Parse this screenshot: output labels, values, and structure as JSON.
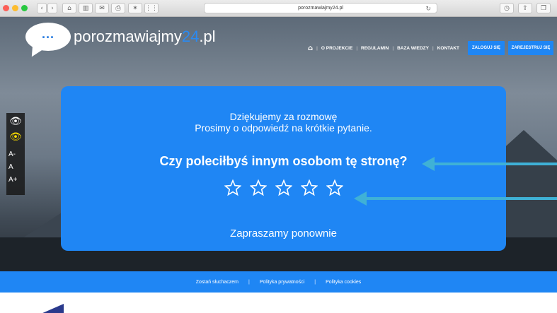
{
  "browser": {
    "url": "porozmawiajmy24.pl"
  },
  "site": {
    "logo_name": "porozmawiajmy",
    "logo_number": "24",
    "logo_tld": ".pl",
    "logo_dots": "..."
  },
  "nav": {
    "items": [
      "O PROJEKCIE",
      "REGULAMIN",
      "BAZA WIEDZY",
      "KONTAKT"
    ],
    "login": "ZALOGUJ SIĘ",
    "register": "ZAREJESTRUJ SIĘ"
  },
  "accessibility": {
    "font_small": "A-",
    "font_normal": "A",
    "font_large": "A+"
  },
  "modal": {
    "thanks_line1": "Dziękujemy za rozmowę",
    "thanks_line2": "Prosimy o odpowiedź na krótkie pytanie.",
    "question": "Czy poleciłbyś innym osobom tę stronę?",
    "rating_max": 5,
    "rating_value": 0,
    "farewell": "Zapraszamy ponownie"
  },
  "footer": {
    "links": [
      "Zostań słuchaczem",
      "Polityka prywatności",
      "Polityka cookies"
    ]
  },
  "colors": {
    "brand_blue": "#1f86f4",
    "arrow": "#3fb1d6",
    "eye_highlight": "#ffe000"
  }
}
